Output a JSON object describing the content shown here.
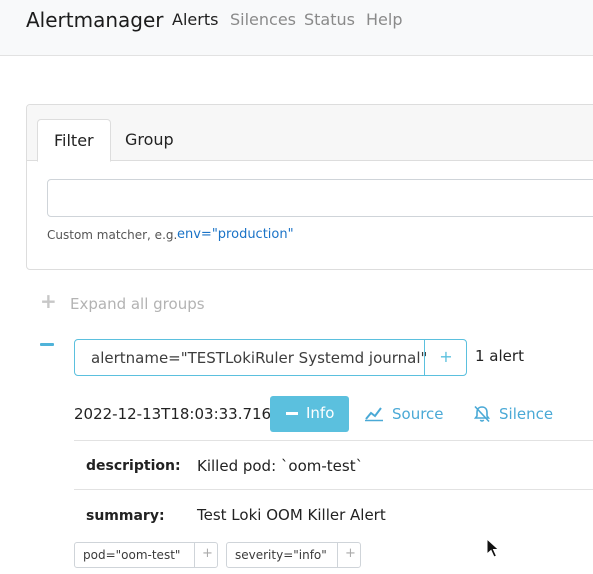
{
  "nav": {
    "brand": "Alertmanager",
    "links": [
      "Alerts",
      "Silences",
      "Status",
      "Help"
    ],
    "active": "Alerts"
  },
  "filter_card": {
    "tabs": [
      "Filter",
      "Group"
    ],
    "active_tab": "Filter",
    "input_value": "",
    "hint_text": "Custom matcher, e.g.",
    "hint_example": "env=\"production\""
  },
  "groups_toolbar": {
    "expand_label": "Expand all groups"
  },
  "group": {
    "label": "alertname=\"TESTLokiRuler Systemd journal\"",
    "add_symbol": "+",
    "count_text": "1 alert",
    "alert": {
      "timestamp": "2022-12-13T18:03:33.716Z",
      "info_label": "Info",
      "source_label": "Source",
      "silence_label": "Silence",
      "annotations": [
        {
          "key": "description:",
          "value": "Killed pod: `oom-test`"
        },
        {
          "key": "summary:",
          "value": "Test Loki OOM Killer Alert"
        }
      ],
      "labels": [
        "pod=\"oom-test\"",
        "severity=\"info\""
      ]
    }
  },
  "colors": {
    "accent": "#5bc0de",
    "link": "#4aa9d6",
    "muted": "#b3b3b3"
  },
  "icons": {
    "expand": "plus-icon",
    "collapse": "minus-icon",
    "source": "chart-line-icon",
    "silence": "bell-slash-icon"
  }
}
